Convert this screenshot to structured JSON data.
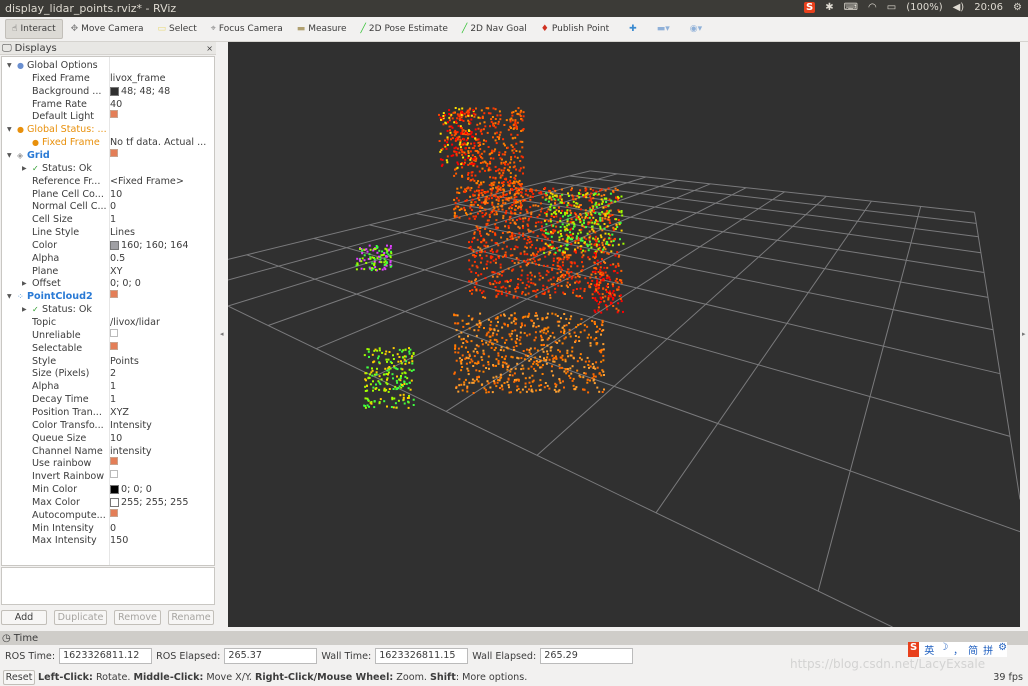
{
  "window": {
    "title": "display_lidar_points.rviz* - RViz"
  },
  "tray": {
    "battery": "(100%)",
    "clock": "20:06",
    "ime_logo": "S"
  },
  "toolbar": [
    {
      "label": "Interact",
      "icon": "cursor-icon",
      "color": "#444444"
    },
    {
      "label": "Move Camera",
      "icon": "move-icon",
      "color": "#888888"
    },
    {
      "label": "Select",
      "icon": "select-rect-icon",
      "color": "#e8d870"
    },
    {
      "label": "Focus Camera",
      "icon": "focus-icon",
      "color": "#888888"
    },
    {
      "label": "Measure",
      "icon": "ruler-icon",
      "color": "#b0a070"
    },
    {
      "label": "2D Pose Estimate",
      "icon": "green-arrow-icon",
      "color": "#30c030"
    },
    {
      "label": "2D Nav Goal",
      "icon": "green-arrow-icon",
      "color": "#30c030"
    },
    {
      "label": "Publish Point",
      "icon": "pin-icon",
      "color": "#d03020"
    }
  ],
  "displays": {
    "title": "Displays",
    "rows": [
      {
        "label": "Global Options",
        "value": "",
        "level": 0,
        "exp": "down",
        "icon": "globe-icon",
        "kind": "group"
      },
      {
        "label": "Fixed Frame",
        "value": "livox_frame",
        "level": 1
      },
      {
        "label": "Background ...",
        "value": "48; 48; 48",
        "level": 1,
        "swatch": "#303030"
      },
      {
        "label": "Frame Rate",
        "value": "40",
        "level": 1
      },
      {
        "label": "Default Light",
        "value": "",
        "level": 1,
        "check": true
      },
      {
        "label": "Global Status: ...",
        "value": "",
        "level": 0,
        "exp": "down",
        "icon": "warning-icon",
        "kind": "warn"
      },
      {
        "label": "Fixed Frame",
        "value": "No tf data.  Actual ...",
        "level": 1,
        "icon": "warning-icon",
        "kind": "warn"
      },
      {
        "label": "Grid",
        "value": "",
        "level": 0,
        "exp": "down",
        "icon": "grid-icon",
        "kind": "display",
        "check": true
      },
      {
        "label": "Status: Ok",
        "value": "",
        "level": 1,
        "exp": "right",
        "icon": "check-icon",
        "kind": "status"
      },
      {
        "label": "Reference Fr...",
        "value": "<Fixed Frame>",
        "level": 1
      },
      {
        "label": "Plane Cell Co...",
        "value": "10",
        "level": 1
      },
      {
        "label": "Normal Cell C...",
        "value": "0",
        "level": 1
      },
      {
        "label": "Cell Size",
        "value": "1",
        "level": 1
      },
      {
        "label": "Line Style",
        "value": "Lines",
        "level": 1
      },
      {
        "label": "Color",
        "value": "160; 160; 164",
        "level": 1,
        "swatch": "#a0a0a4"
      },
      {
        "label": "Alpha",
        "value": "0.5",
        "level": 1
      },
      {
        "label": "Plane",
        "value": "XY",
        "level": 1
      },
      {
        "label": "Offset",
        "value": "0; 0; 0",
        "level": 1,
        "exp": "right"
      },
      {
        "label": "PointCloud2",
        "value": "",
        "level": 0,
        "exp": "down",
        "icon": "pointcloud-icon",
        "kind": "display",
        "check": true
      },
      {
        "label": "Status: Ok",
        "value": "",
        "level": 1,
        "exp": "right",
        "icon": "check-icon",
        "kind": "status"
      },
      {
        "label": "Topic",
        "value": "/livox/lidar",
        "level": 1
      },
      {
        "label": "Unreliable",
        "value": "",
        "level": 1,
        "check": false
      },
      {
        "label": "Selectable",
        "value": "",
        "level": 1,
        "check": true
      },
      {
        "label": "Style",
        "value": "Points",
        "level": 1
      },
      {
        "label": "Size (Pixels)",
        "value": "2",
        "level": 1
      },
      {
        "label": "Alpha",
        "value": "1",
        "level": 1
      },
      {
        "label": "Decay Time",
        "value": "1",
        "level": 1
      },
      {
        "label": "Position Tran...",
        "value": "XYZ",
        "level": 1
      },
      {
        "label": "Color Transfo...",
        "value": "Intensity",
        "level": 1
      },
      {
        "label": "Queue Size",
        "value": "10",
        "level": 1
      },
      {
        "label": "Channel Name",
        "value": "intensity",
        "level": 1
      },
      {
        "label": "Use rainbow",
        "value": "",
        "level": 1,
        "check": true
      },
      {
        "label": "Invert Rainbow",
        "value": "",
        "level": 1,
        "check": false
      },
      {
        "label": "Min Color",
        "value": "0; 0; 0",
        "level": 1,
        "swatch": "#000000"
      },
      {
        "label": "Max Color",
        "value": "255; 255; 255",
        "level": 1,
        "swatch": "#ffffff"
      },
      {
        "label": "Autocompute...",
        "value": "",
        "level": 1,
        "check": true
      },
      {
        "label": "Min Intensity",
        "value": "0",
        "level": 1
      },
      {
        "label": "Max Intensity",
        "value": "150",
        "level": 1
      }
    ],
    "buttons": {
      "add": "Add",
      "duplicate": "Duplicate",
      "remove": "Remove",
      "rename": "Rename"
    }
  },
  "time": {
    "title": "Time",
    "ros_time_label": "ROS Time:",
    "ros_time": "1623326811.12",
    "ros_elapsed_label": "ROS Elapsed:",
    "ros_elapsed": "265.37",
    "wall_time_label": "Wall Time:",
    "wall_time": "1623326811.15",
    "wall_elapsed_label": "Wall Elapsed:",
    "wall_elapsed": "265.29"
  },
  "status": {
    "reset": "Reset",
    "b1": "Left-Click:",
    "t1": " Rotate. ",
    "b2": "Middle-Click:",
    "t2": " Move X/Y. ",
    "b3": "Right-Click/Mouse Wheel:",
    "t3": " Zoom. ",
    "b4": "Shift",
    "t4": ": More options.",
    "fps": "39 fps"
  },
  "ime": {
    "items": [
      "英",
      "☽",
      "，",
      "简",
      "拼",
      "⚙"
    ]
  },
  "watermark": "https://blog.csdn.net/LacyExsale",
  "colors": {
    "warn": "#e8900c",
    "display": "#2a7ad5",
    "background": "#303030",
    "grid": "#a0a0a4"
  }
}
